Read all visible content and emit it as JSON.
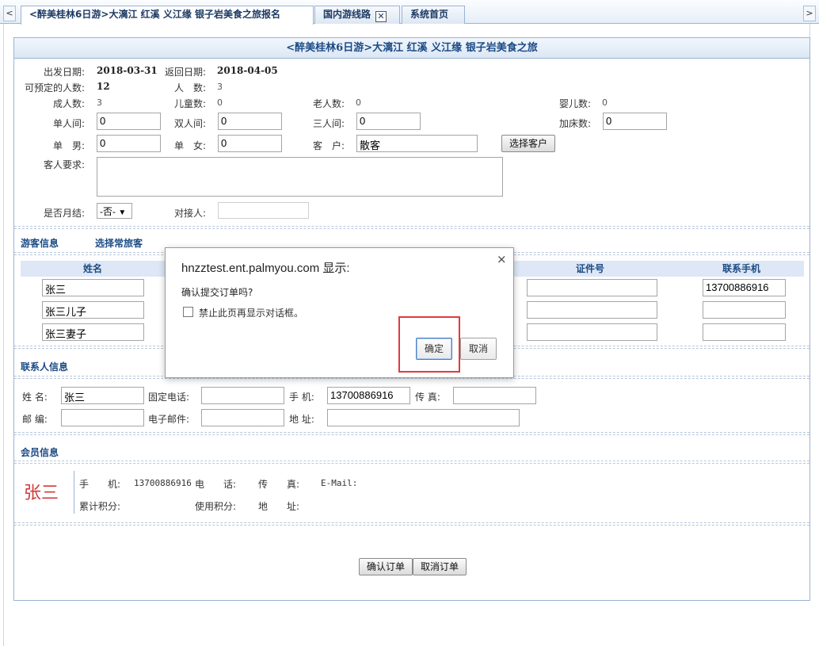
{
  "tabs": [
    {
      "label": "<醉美桂林6日游>大漓江 红溪 义江缘 银子岩美食之旅报名",
      "active": true
    },
    {
      "label": "国内游线路",
      "closable": true
    },
    {
      "label": "系统首页"
    }
  ],
  "tab_scroll": {
    "left": "<",
    "right": ">"
  },
  "panel_title": "<醉美桂林6日游>大漓江 红溪 义江缘 银子岩美食之旅",
  "trip": {
    "depart_label": "出发日期:",
    "depart_value": "2018-03-31",
    "return_label": "返回日期:",
    "return_value": "2018-04-05",
    "bookable_label": "可预定的人数:",
    "bookable_value": "12",
    "people_label": "人　数:",
    "people_value": "3",
    "adult_label": "成人数:",
    "adult_value": "3",
    "child_label": "儿童数:",
    "child_value": "0",
    "elder_label": "老人数:",
    "elder_value": "0",
    "infant_label": "婴儿数:",
    "infant_value": "0"
  },
  "rooms": {
    "single_label": "单人间:",
    "single_value": "0",
    "double_label": "双人间:",
    "double_value": "0",
    "triple_label": "三人间:",
    "triple_value": "0",
    "extra_bed_label": "加床数:",
    "extra_bed_value": "0",
    "single_male_label": "单　男:",
    "single_male_value": "0",
    "single_female_label": "单　女:",
    "single_female_value": "0",
    "customer_label": "客　户:",
    "customer_value": "散客",
    "select_customer_button": "选择客户"
  },
  "requirements_label": "客人要求:",
  "requirements_value": "",
  "monthly": {
    "label": "是否月结:",
    "value": "-否-",
    "arrow": "▼"
  },
  "contact_person_label": "对接人:",
  "contact_person_value": "",
  "tourist_section": {
    "title": "游客信息",
    "select_link": "选择常旅客"
  },
  "tourist_columns": {
    "name": "姓名",
    "id_no": "证件号",
    "mobile": "联系手机"
  },
  "tourists": [
    {
      "name": "张三",
      "id_no": "",
      "mobile": "13700886916"
    },
    {
      "name": "张三儿子",
      "id_no": "",
      "mobile": ""
    },
    {
      "name": "张三妻子",
      "id_no": "",
      "mobile": ""
    }
  ],
  "contact_section": {
    "title": "联系人信息",
    "name_label": "姓 名:",
    "name_value": "张三",
    "phone_label": "固定电话:",
    "phone_value": "",
    "mobile_label": "手 机:",
    "mobile_value": "13700886916",
    "fax_label": "传 真:",
    "fax_value": "",
    "zip_label": "邮 编:",
    "zip_value": "",
    "email_label": "电子邮件:",
    "email_value": "",
    "address_label": "地 址:",
    "address_value": ""
  },
  "member_section": {
    "title": "会员信息",
    "name": "张三",
    "mobile_label": "手　　机:",
    "mobile_value": "13700886916",
    "tel_label": "电　　话:",
    "fax_label": "传　　真:",
    "email_label": "E-Mail:",
    "points_label": "累计积分:",
    "used_points_label": "使用积分:",
    "address_label": "地　　址:"
  },
  "actions": {
    "confirm": "确认订单",
    "cancel": "取消订单"
  },
  "dialog": {
    "close": "×",
    "title": "hnzztest.ent.palmyou.com 显示:",
    "message": "确认提交订单吗?",
    "checkbox_label": "禁止此页再显示对话框。",
    "ok": "确定",
    "cancel": "取消"
  },
  "colors": {
    "accent": "#1c4b85",
    "highlight": "#e23a3a",
    "member_name": "#d23b3b"
  }
}
